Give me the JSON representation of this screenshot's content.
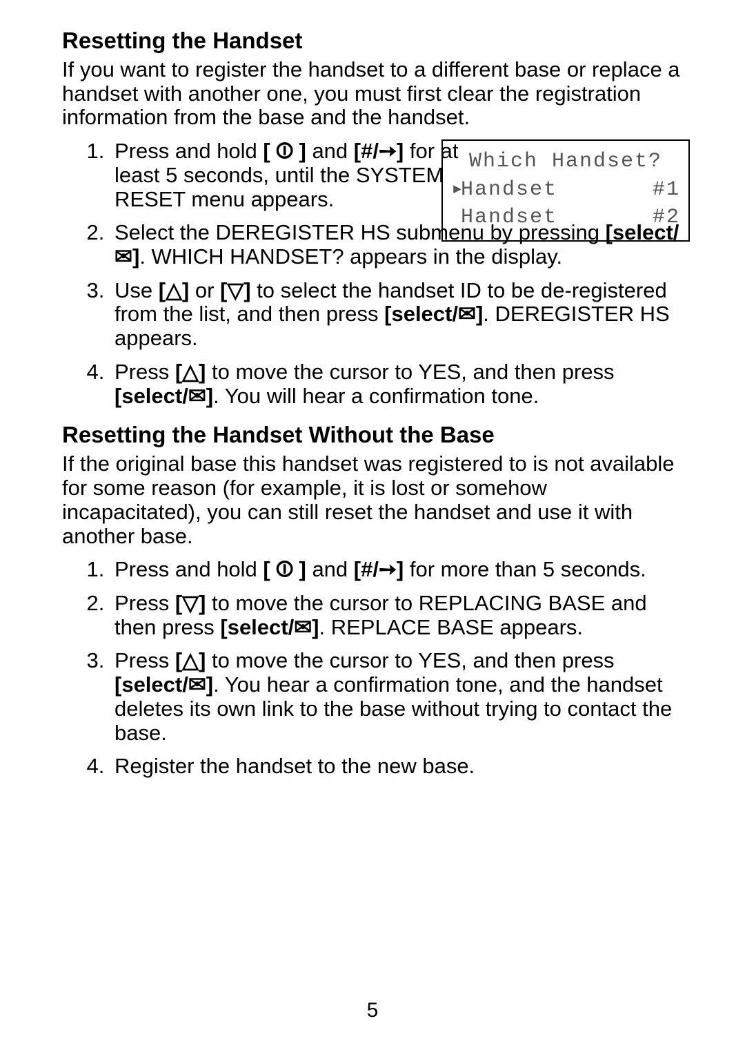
{
  "section1": {
    "heading": "Resetting the Handset",
    "intro": "If you want to register the handset to a different base or replace a handset with another one, you must first clear the registration information from the base and the handset.",
    "steps": {
      "s1a": "Press and hold ",
      "s1b": " and ",
      "s1c": " for at least 5 seconds, until the SYSTEM RESET menu appears.",
      "s2a": "Select the DEREGISTER HS submenu by pressing ",
      "s2b": ". WHICH HANDSET? appears in the display.",
      "s3a": "Use ",
      "s3b": " or ",
      "s3c": " to select the handset ID to be de-registered from the list, and then press ",
      "s3d": ". DEREGISTER HS appears.",
      "s4a": "Press ",
      "s4b": " to move the cursor to YES, and then press ",
      "s4c": ". You will hear a confirmation tone."
    }
  },
  "lcd": {
    "title": "Which Handset?",
    "row1_label": "Handset",
    "row1_val": "#1",
    "row2_label": "Handset",
    "row2_val": "#2"
  },
  "section2": {
    "heading": "Resetting the Handset Without the Base",
    "intro": "If the original base this handset was registered to is not available for some reason (for example, it is lost or somehow incapacitated), you can still reset the handset and use it with another base.",
    "steps": {
      "s1a": "Press and hold ",
      "s1b": " and ",
      "s1c": " for more than 5 seconds.",
      "s2a": "Press ",
      "s2b": " to move the cursor to REPLACING BASE and then press ",
      "s2c": ". REPLACE BASE appears.",
      "s3a": "Press ",
      "s3b": " to move the cursor to YES, and then press ",
      "s3c": ". You hear a confirmation tone, and the handset deletes its own link to the base without trying to contact the base.",
      "s4": "Register the handset to the new base."
    }
  },
  "keys": {
    "end": "[ ⏼ ]",
    "hash_right": "[#/➙]",
    "select": "[select/✉]",
    "up": "[△]",
    "down": "[▽]"
  },
  "page_number": "5"
}
